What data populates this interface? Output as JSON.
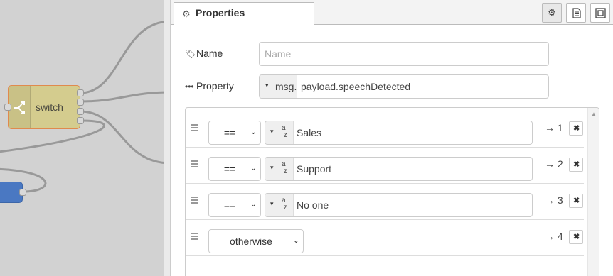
{
  "workspace": {
    "switch_node_label": "switch",
    "blue_node_label": "",
    "colors": {
      "switch_fill": "#d4cc8e",
      "switch_border": "#e08a4d",
      "blue_fill": "#4a78c2",
      "wire": "#999999",
      "canvas": "#d2d2d2"
    }
  },
  "tray": {
    "tab": {
      "label": "Properties",
      "icon": "gear-icon"
    },
    "buttons": [
      {
        "name": "settings",
        "icon": "gear-icon"
      },
      {
        "name": "description",
        "icon": "document-icon"
      },
      {
        "name": "appearance",
        "icon": "frame-icon"
      }
    ],
    "name_field": {
      "label": "Name",
      "icon": "tag-icon",
      "value": "",
      "placeholder": "Name"
    },
    "property_field": {
      "label": "Property",
      "icon": "ellipsis-icon",
      "type": "msg.",
      "value": "payload.speechDetected"
    },
    "rules": [
      {
        "operator": "==",
        "value_type_icon": "az-string-icon",
        "value": "Sales",
        "output": "→ 1"
      },
      {
        "operator": "==",
        "value_type_icon": "az-string-icon",
        "value": "Support",
        "output": "→ 2"
      },
      {
        "operator": "==",
        "value_type_icon": "az-string-icon",
        "value": "No one",
        "output": "→ 3"
      },
      {
        "operator": "otherwise",
        "value": "",
        "output": "→ 4"
      }
    ],
    "glyphs": {
      "caret": "▾",
      "chevron": "⌄",
      "delete": "✖",
      "az": "a z"
    }
  }
}
